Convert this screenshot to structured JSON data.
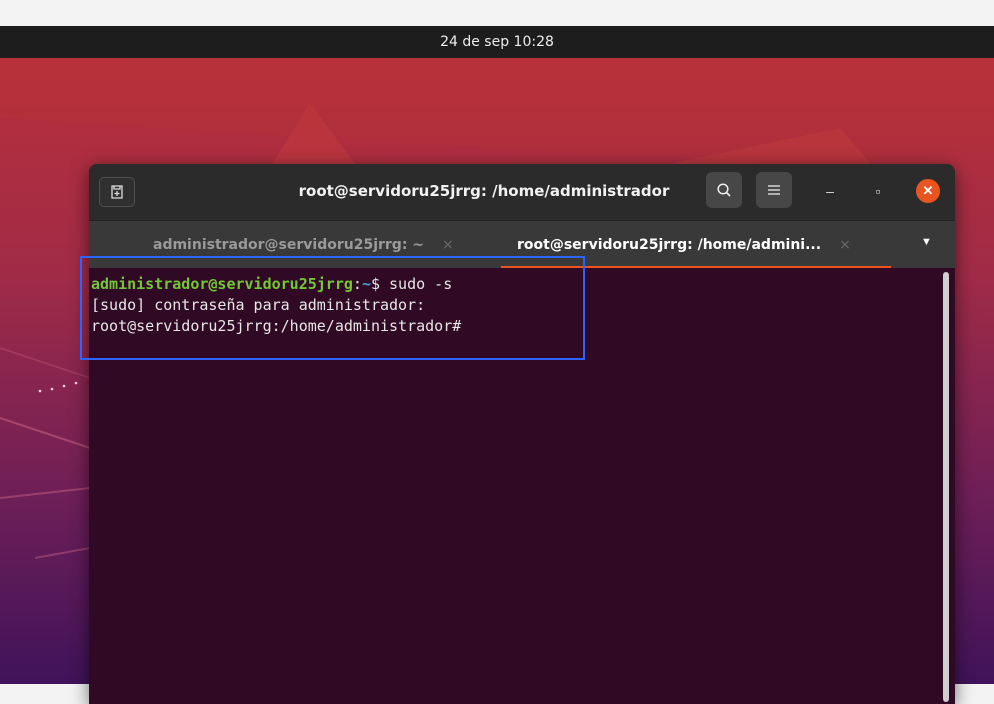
{
  "topbar": {
    "datetime": "24 de sep  10:28"
  },
  "window": {
    "title": "root@servidoru25jrrg: /home/administrador",
    "new_tab_icon": "new-tab-icon",
    "search_icon": "search-icon",
    "menu_icon": "hamburger-menu-icon",
    "minimize_glyph": "–",
    "maximize_glyph": "▫",
    "close_glyph": "✕"
  },
  "tabs": [
    {
      "label": "administrador@servidoru25jrrg: ~",
      "close": "×",
      "active": false
    },
    {
      "label": "root@servidoru25jrrg: /home/admini...",
      "close": "×",
      "active": true
    }
  ],
  "tab_menu_glyph": "▼",
  "terminal": {
    "line1_user": "administrador@servidoru25jrrg",
    "line1_sep": ":",
    "line1_path": "~",
    "line1_cmd": "$ sudo -s",
    "line2": "[sudo] contraseña para administrador:",
    "line3": "root@servidoru25jrrg:/home/administrador#"
  },
  "colors": {
    "accent": "#e95420",
    "terminal_bg": "#300a24",
    "prompt_user": "#73c935",
    "prompt_path": "#4e9ad8",
    "highlight_box": "#2d63ff"
  }
}
